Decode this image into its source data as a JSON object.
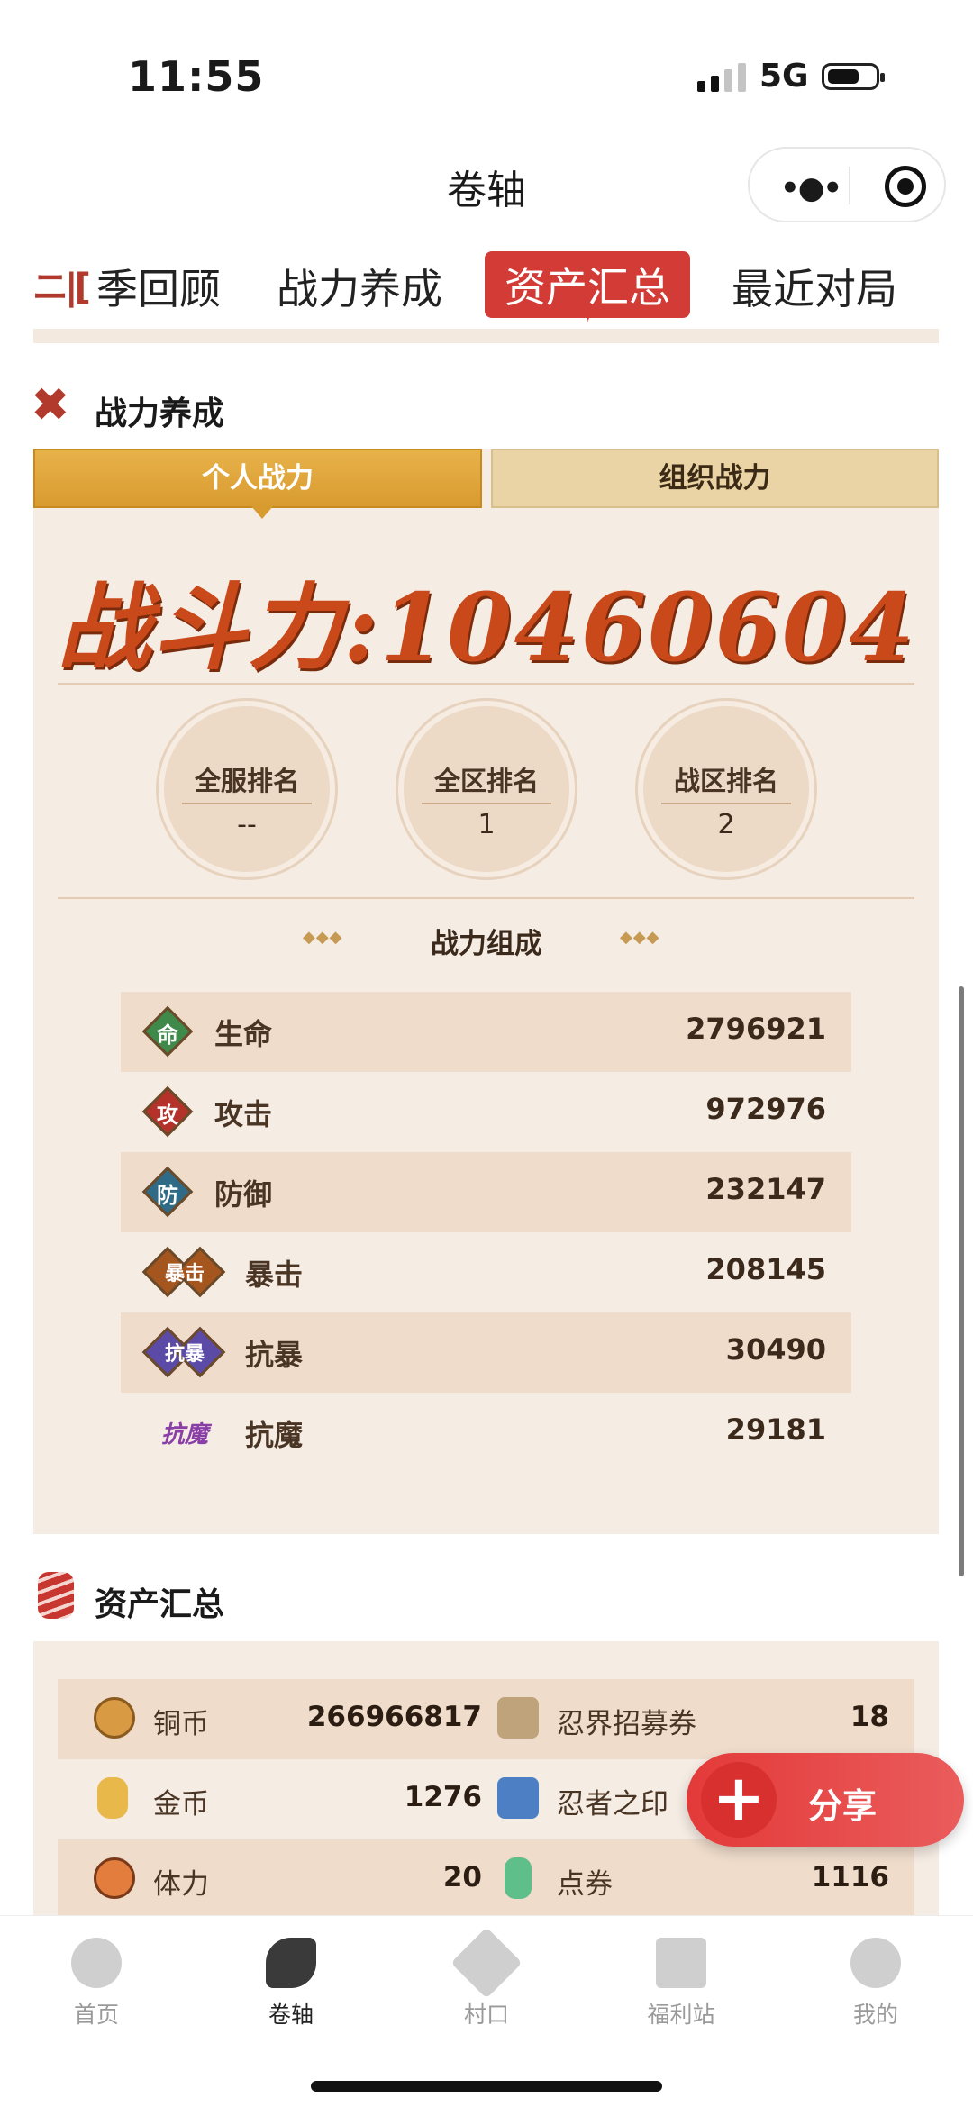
{
  "status_bar": {
    "time": "11:55",
    "network": "5G"
  },
  "nav_bar": {
    "title": "卷轴"
  },
  "tabs": [
    {
      "label": "季回顾"
    },
    {
      "label": "战力养成"
    },
    {
      "label": "资产汇总",
      "active": true
    },
    {
      "label": "最近对局"
    }
  ],
  "power_section": {
    "title": "战力养成",
    "segments": [
      "个人战力",
      "组织战力"
    ],
    "power_label": "战斗力:",
    "power_value": "10460604",
    "ranks": [
      {
        "label": "全服排名",
        "value": "--"
      },
      {
        "label": "全区排名",
        "value": "1"
      },
      {
        "label": "战区排名",
        "value": "2"
      }
    ],
    "composition_title": "战力组成",
    "stats": [
      {
        "icon_text": "命",
        "name": "生命",
        "value": "2796921",
        "color": "#3f8a4a"
      },
      {
        "icon_text": "攻",
        "name": "攻击",
        "value": "972976",
        "color": "#b5322b"
      },
      {
        "icon_text": "防",
        "name": "防御",
        "value": "232147",
        "color": "#2f6b86"
      },
      {
        "icon_text": "暴击",
        "name": "暴击",
        "value": "208145",
        "color": "#a5561f"
      },
      {
        "icon_text": "抗暴",
        "name": "抗暴",
        "value": "30490",
        "color": "#5b4aa6"
      },
      {
        "icon_text": "抗魔",
        "name": "抗魔",
        "value": "29181",
        "color": "#8a3fa6"
      }
    ]
  },
  "asset_section": {
    "title": "资产汇总",
    "rows": [
      {
        "left_name": "铜币",
        "left_value": "266966817",
        "right_name": "忍界招募券",
        "right_value": "18"
      },
      {
        "left_name": "金币",
        "left_value": "1276",
        "right_name": "忍者之印",
        "right_value": ""
      },
      {
        "left_name": "体力",
        "left_value": "20",
        "right_name": "点券",
        "right_value": "1116"
      }
    ]
  },
  "share_button": {
    "label": "分享"
  },
  "bottom_nav": [
    {
      "label": "首页",
      "icon": "home-icon"
    },
    {
      "label": "卷轴",
      "icon": "scroll-icon",
      "active": true
    },
    {
      "label": "村口",
      "icon": "pinwheel-icon"
    },
    {
      "label": "福利站",
      "icon": "gift-icon"
    },
    {
      "label": "我的",
      "icon": "profile-icon"
    }
  ]
}
